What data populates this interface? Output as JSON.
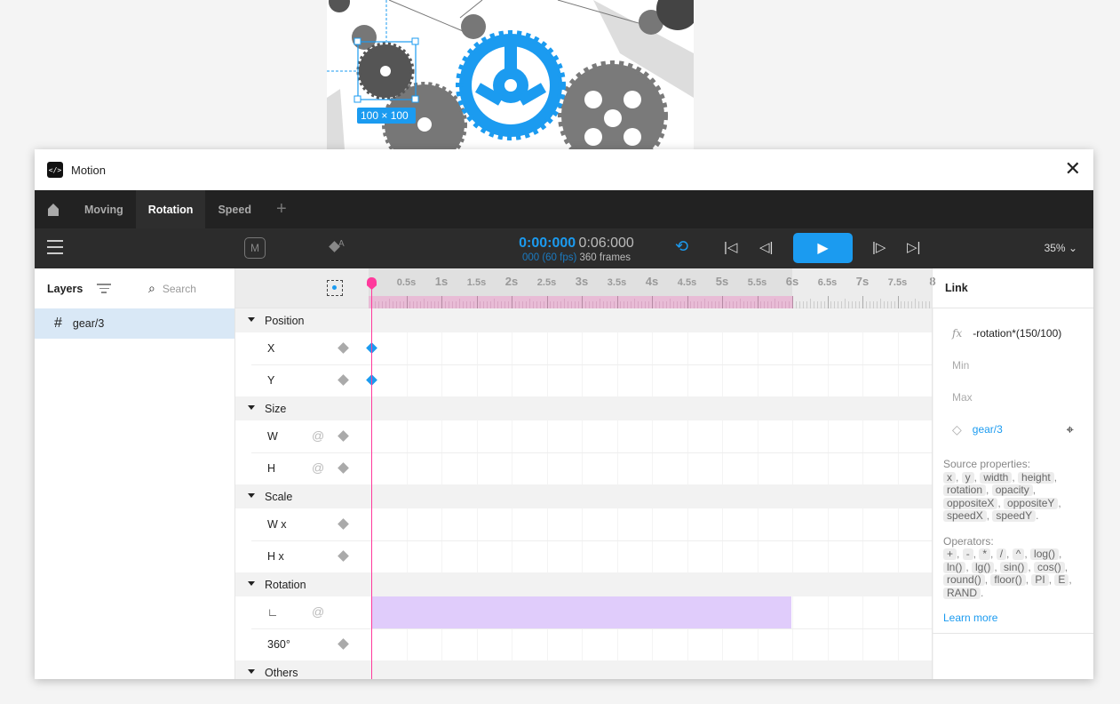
{
  "canvas": {
    "selection_size": "100 × 100",
    "accent": "#1b9bf0"
  },
  "window": {
    "title": "Motion",
    "logo": "</>"
  },
  "tabs": [
    {
      "label": "Moving"
    },
    {
      "label": "Rotation",
      "active": true
    },
    {
      "label": "Speed"
    }
  ],
  "toolbar": {
    "m_label": "M",
    "auto_key": "A",
    "current_time": "0:00:000",
    "total_time": "0:06:000",
    "current_frame": "000 (60 fps)",
    "total_frames": "360 frames",
    "zoom": "35%"
  },
  "layers": {
    "title": "Layers",
    "search_placeholder": "Search",
    "items": [
      {
        "name": "gear/3",
        "icon": "frame-hash-icon",
        "selected": true
      }
    ]
  },
  "timeline": {
    "ruler_labels": [
      "0",
      "0.5s",
      "1s",
      "1.5s",
      "2s",
      "2.5s",
      "3s",
      "3.5s",
      "4s",
      "4.5s",
      "5s",
      "5.5s",
      "6s",
      "6.5s",
      "7s",
      "7.5s",
      "8"
    ],
    "duration_seconds": 6,
    "playhead_seconds": 0,
    "groups": [
      {
        "name": "Position",
        "props": [
          {
            "name": "X",
            "keyframe_at_0": true
          },
          {
            "name": "Y",
            "keyframe_at_0": true
          }
        ]
      },
      {
        "name": "Size",
        "props": [
          {
            "name": "W",
            "spiral": true
          },
          {
            "name": "H",
            "spiral": true
          }
        ]
      },
      {
        "name": "Scale",
        "props": [
          {
            "name": "W x"
          },
          {
            "name": "H x"
          }
        ]
      },
      {
        "name": "Rotation",
        "props": [
          {
            "name": "∟",
            "spiral": true,
            "linked": true
          },
          {
            "name": "360°"
          }
        ]
      },
      {
        "name": "Others",
        "props": []
      }
    ]
  },
  "link_panel": {
    "title": "Link",
    "fx_icon": "fx",
    "expression": "-rotation*(150/100)",
    "min_label": "Min",
    "max_label": "Max",
    "source_layer": "gear/3",
    "source_properties_label": "Source properties:",
    "source_properties": [
      "x",
      "y",
      "width",
      "height",
      "rotation",
      "opacity",
      "oppositeX",
      "oppositeY",
      "speedX",
      "speedY"
    ],
    "operators_label": "Operators:",
    "operators": [
      "+",
      "-",
      "*",
      "/",
      "^",
      "log()",
      "ln()",
      "lg()",
      "sin()",
      "cos()",
      "round()",
      "floor()",
      "PI",
      "E",
      "RAND"
    ],
    "learn_more": "Learn more"
  }
}
